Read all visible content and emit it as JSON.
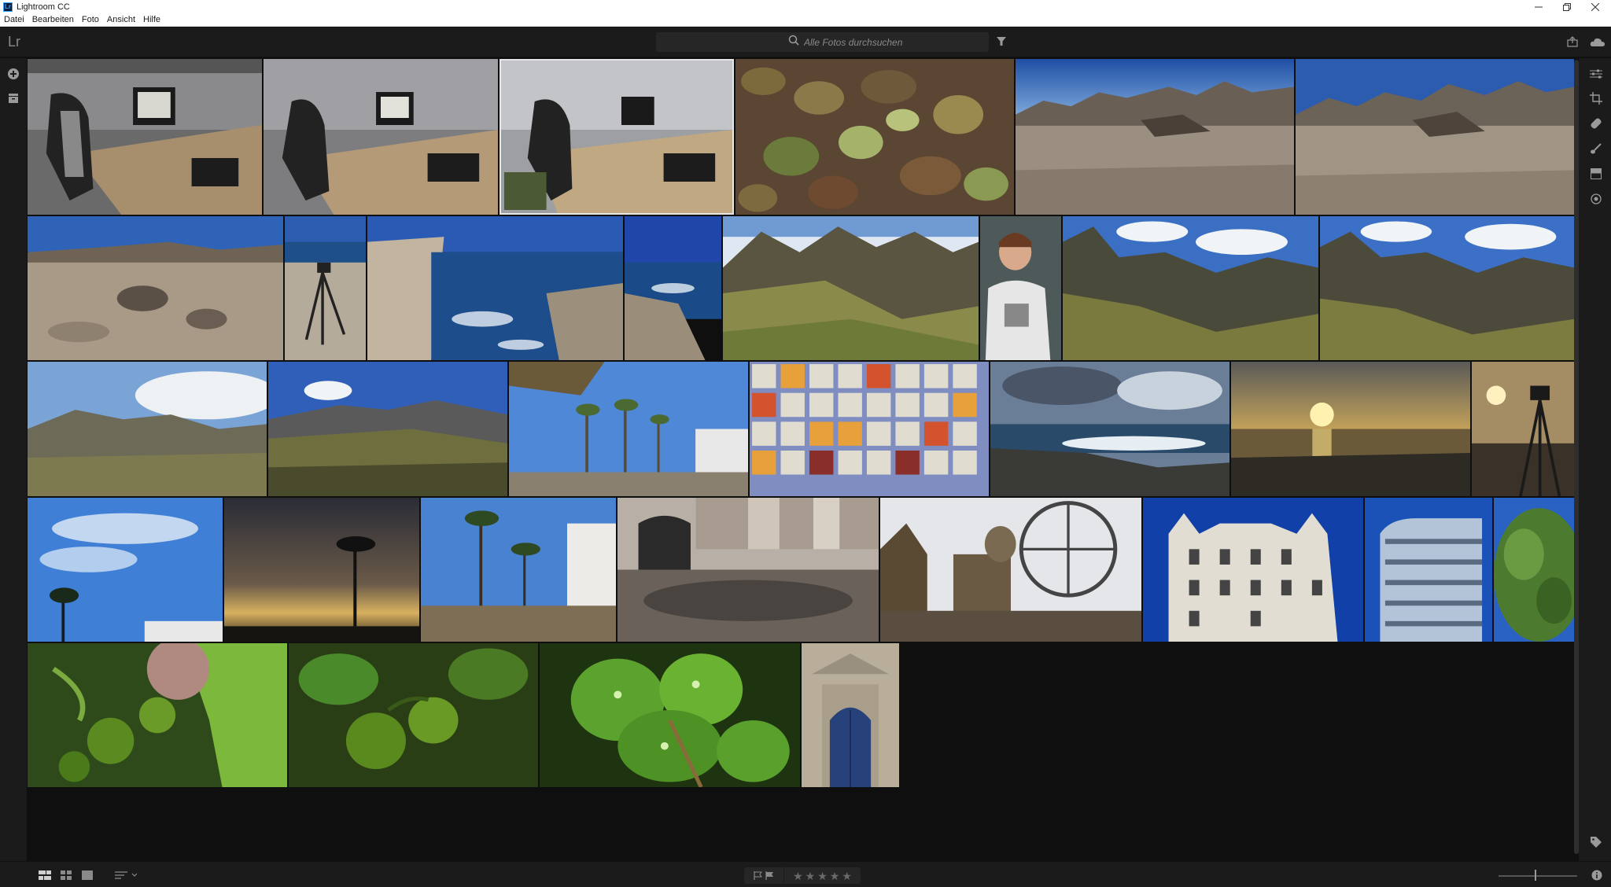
{
  "window": {
    "title": "Lightroom CC",
    "app_icon_text": "Lr"
  },
  "menu": {
    "items": [
      "Datei",
      "Bearbeiten",
      "Foto",
      "Ansicht",
      "Hilfe"
    ]
  },
  "header": {
    "logo": "Lr",
    "search": {
      "placeholder": "Alle Fotos durchsuchen",
      "value": ""
    }
  },
  "left_rail": {
    "icons": [
      "add-photos-icon",
      "library-icon"
    ]
  },
  "right_rail": {
    "icons": [
      "edit-sliders-icon",
      "crop-icon",
      "healing-icon",
      "brush-icon",
      "linear-gradient-icon",
      "radial-gradient-icon",
      "tag-icon",
      "info-icon"
    ]
  },
  "top_right": {
    "icons": [
      "share-icon",
      "cloud-sync-icon"
    ]
  },
  "bottom_bar": {
    "view_modes": [
      "photo-grid-icon",
      "square-grid-icon",
      "detail-icon"
    ],
    "sort_icon": "sort-icon",
    "flags": [
      "pick-flag-icon",
      "reject-flag-icon"
    ],
    "stars": [
      "★",
      "★",
      "★",
      "★",
      "★"
    ],
    "rating": 0
  },
  "photos": [
    {
      "name": "desk-gaming-chair-1",
      "row": 1,
      "selected": false
    },
    {
      "name": "desk-gaming-chair-2",
      "row": 1,
      "selected": false
    },
    {
      "name": "desk-gaming-chair-3",
      "row": 1,
      "selected": true
    },
    {
      "name": "autumn-leaves",
      "row": 1,
      "selected": false
    },
    {
      "name": "volcanic-desert-1",
      "row": 1,
      "selected": false
    },
    {
      "name": "volcanic-desert-2",
      "row": 1,
      "selected": false
    },
    {
      "name": "rocky-plateau",
      "row": 2,
      "selected": false
    },
    {
      "name": "camera-tripod-coast",
      "row": 2,
      "selected": false
    },
    {
      "name": "rock-pool-sea",
      "row": 2,
      "selected": false
    },
    {
      "name": "cliff-sea-blue",
      "row": 2,
      "selected": false
    },
    {
      "name": "green-mountain-valley",
      "row": 2,
      "selected": false
    },
    {
      "name": "woman-portrait",
      "row": 2,
      "selected": false
    },
    {
      "name": "mountain-ridge-clouds-1",
      "row": 2,
      "selected": false
    },
    {
      "name": "mountain-ridge-clouds-2",
      "row": 2,
      "selected": false
    },
    {
      "name": "hills-clouds",
      "row": 3,
      "selected": false
    },
    {
      "name": "volcano-hillside",
      "row": 3,
      "selected": false
    },
    {
      "name": "palm-trees-hotel",
      "row": 3,
      "selected": false
    },
    {
      "name": "tile-pattern",
      "row": 3,
      "selected": false
    },
    {
      "name": "stormy-coast",
      "row": 3,
      "selected": false
    },
    {
      "name": "sunset-sea",
      "row": 3,
      "selected": false
    },
    {
      "name": "tripod-sunset",
      "row": 3,
      "selected": false
    },
    {
      "name": "blue-sky-palm",
      "row": 4,
      "selected": false
    },
    {
      "name": "palm-silhouette-sunset",
      "row": 4,
      "selected": false
    },
    {
      "name": "palms-hotel-garden",
      "row": 4,
      "selected": false
    },
    {
      "name": "town-square-concert",
      "row": 4,
      "selected": false
    },
    {
      "name": "ferris-wheel-cathedral",
      "row": 4,
      "selected": false
    },
    {
      "name": "ornate-building",
      "row": 4,
      "selected": false
    },
    {
      "name": "modern-curved-building",
      "row": 4,
      "selected": false
    },
    {
      "name": "green-tree",
      "row": 4,
      "selected": false
    },
    {
      "name": "green-tomatoes-1",
      "row": 5,
      "selected": false
    },
    {
      "name": "green-tomatoes-2",
      "row": 5,
      "selected": false
    },
    {
      "name": "wet-leaves",
      "row": 5,
      "selected": false
    },
    {
      "name": "blue-door-portal",
      "row": 5,
      "selected": false
    }
  ],
  "colors": {
    "background": "#0f0f0f",
    "panel": "#1b1b1b",
    "selection": "#e6e6e6",
    "icon": "#9a9a9a"
  }
}
